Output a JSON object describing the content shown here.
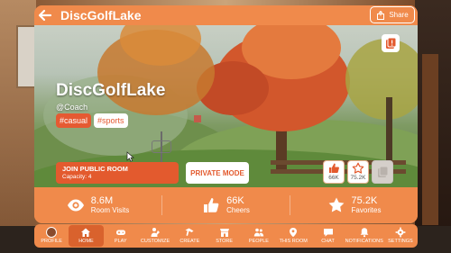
{
  "header": {
    "room_name": "DiscGolfLake",
    "share_label": "Share"
  },
  "room": {
    "title": "DiscGolfLake",
    "creator": "@Coach",
    "tags": [
      "#casual",
      "#sports"
    ]
  },
  "actions": {
    "join_label": "JOIN PUBLIC ROOM",
    "capacity": "Capacity: 4",
    "private_label": "PRIVATE MODE",
    "cheer_count": "66K",
    "favorite_count": "75.2K"
  },
  "stats": {
    "visits_value": "8.6M",
    "visits_label": "Room Visits",
    "cheers_value": "66K",
    "cheers_label": "Cheers",
    "favorites_value": "75.2K",
    "favorites_label": "Favorites"
  },
  "nav": {
    "items": [
      "PROFILE",
      "HOME",
      "PLAY",
      "CUSTOMIZE",
      "CREATE",
      "STORE",
      "PEOPLE",
      "THIS ROOM",
      "CHAT",
      "NOTIFICATIONS",
      "SETTINGS"
    ],
    "active": "HOME"
  },
  "icons": {
    "back": "back-arrow-icon",
    "share": "share-icon",
    "report": "report-icon",
    "cheer": "thumbs-up-icon",
    "favorite": "star-icon",
    "disabled": "disabled-icon",
    "visits": "eye-icon"
  },
  "colors": {
    "accent": "#f08a4b",
    "button_primary": "#e35a2e",
    "nav_active": "#d9622d"
  }
}
